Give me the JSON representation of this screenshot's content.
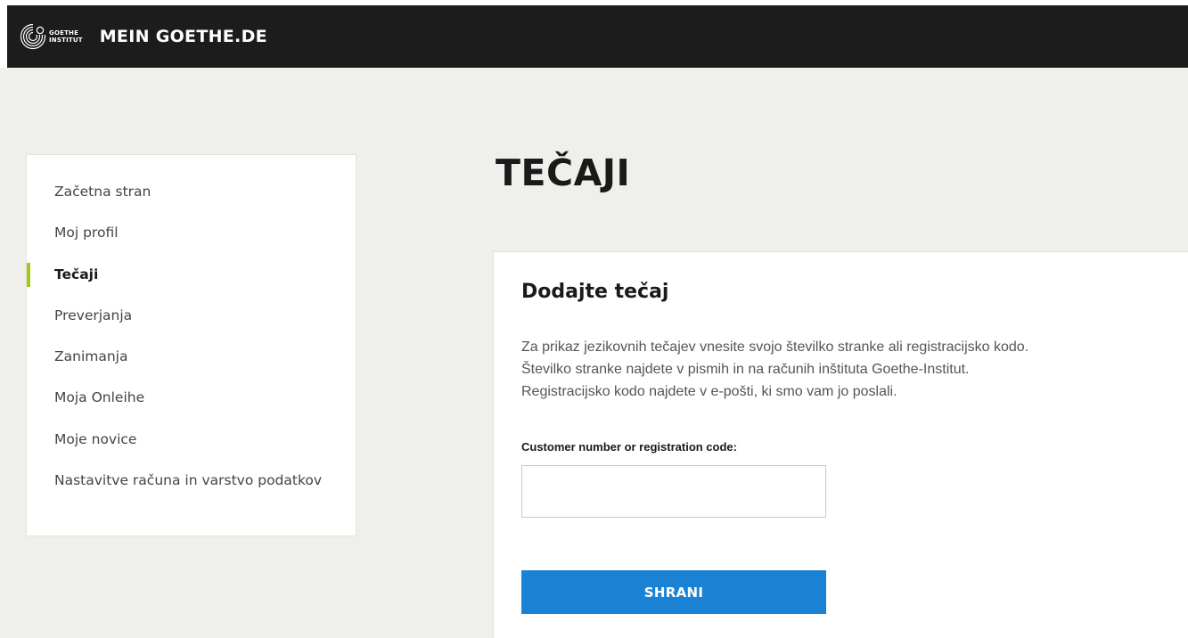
{
  "header": {
    "logo": {
      "line1": "GOETHE",
      "line2": "INSTITUT",
      "icon": "goethe-logo-icon"
    },
    "site_title": "MEIN GOETHE.DE",
    "background": "#1c1c1c"
  },
  "sidebar": {
    "items": [
      {
        "label": "Začetna stran",
        "active": false
      },
      {
        "label": "Moj profil",
        "active": false
      },
      {
        "label": "Tečaji",
        "active": true
      },
      {
        "label": "Preverjanja",
        "active": false
      },
      {
        "label": "Zanimanja",
        "active": false
      },
      {
        "label": "Moja Onleihe",
        "active": false
      },
      {
        "label": "Moje novice",
        "active": false
      },
      {
        "label": "Nastavitve računa in varstvo podatkov",
        "active": false
      }
    ],
    "active_indicator_color": "#a0c814"
  },
  "main": {
    "page_title": "TEČAJI",
    "card": {
      "title": "Dodajte tečaj",
      "description": [
        "Za prikaz jezikovnih tečajev vnesite svojo številko stranke ali registracijsko kodo.",
        "Številko stranke najdete v pismih in na računih inštituta Goethe-Institut.",
        "Registracijsko kodo najdete v e-pošti, ki smo vam jo poslali."
      ],
      "field_label": "Customer number or registration code:",
      "field_value": "",
      "field_placeholder": "",
      "save_label": "SHRANI",
      "button_color": "#1a82d4"
    }
  }
}
